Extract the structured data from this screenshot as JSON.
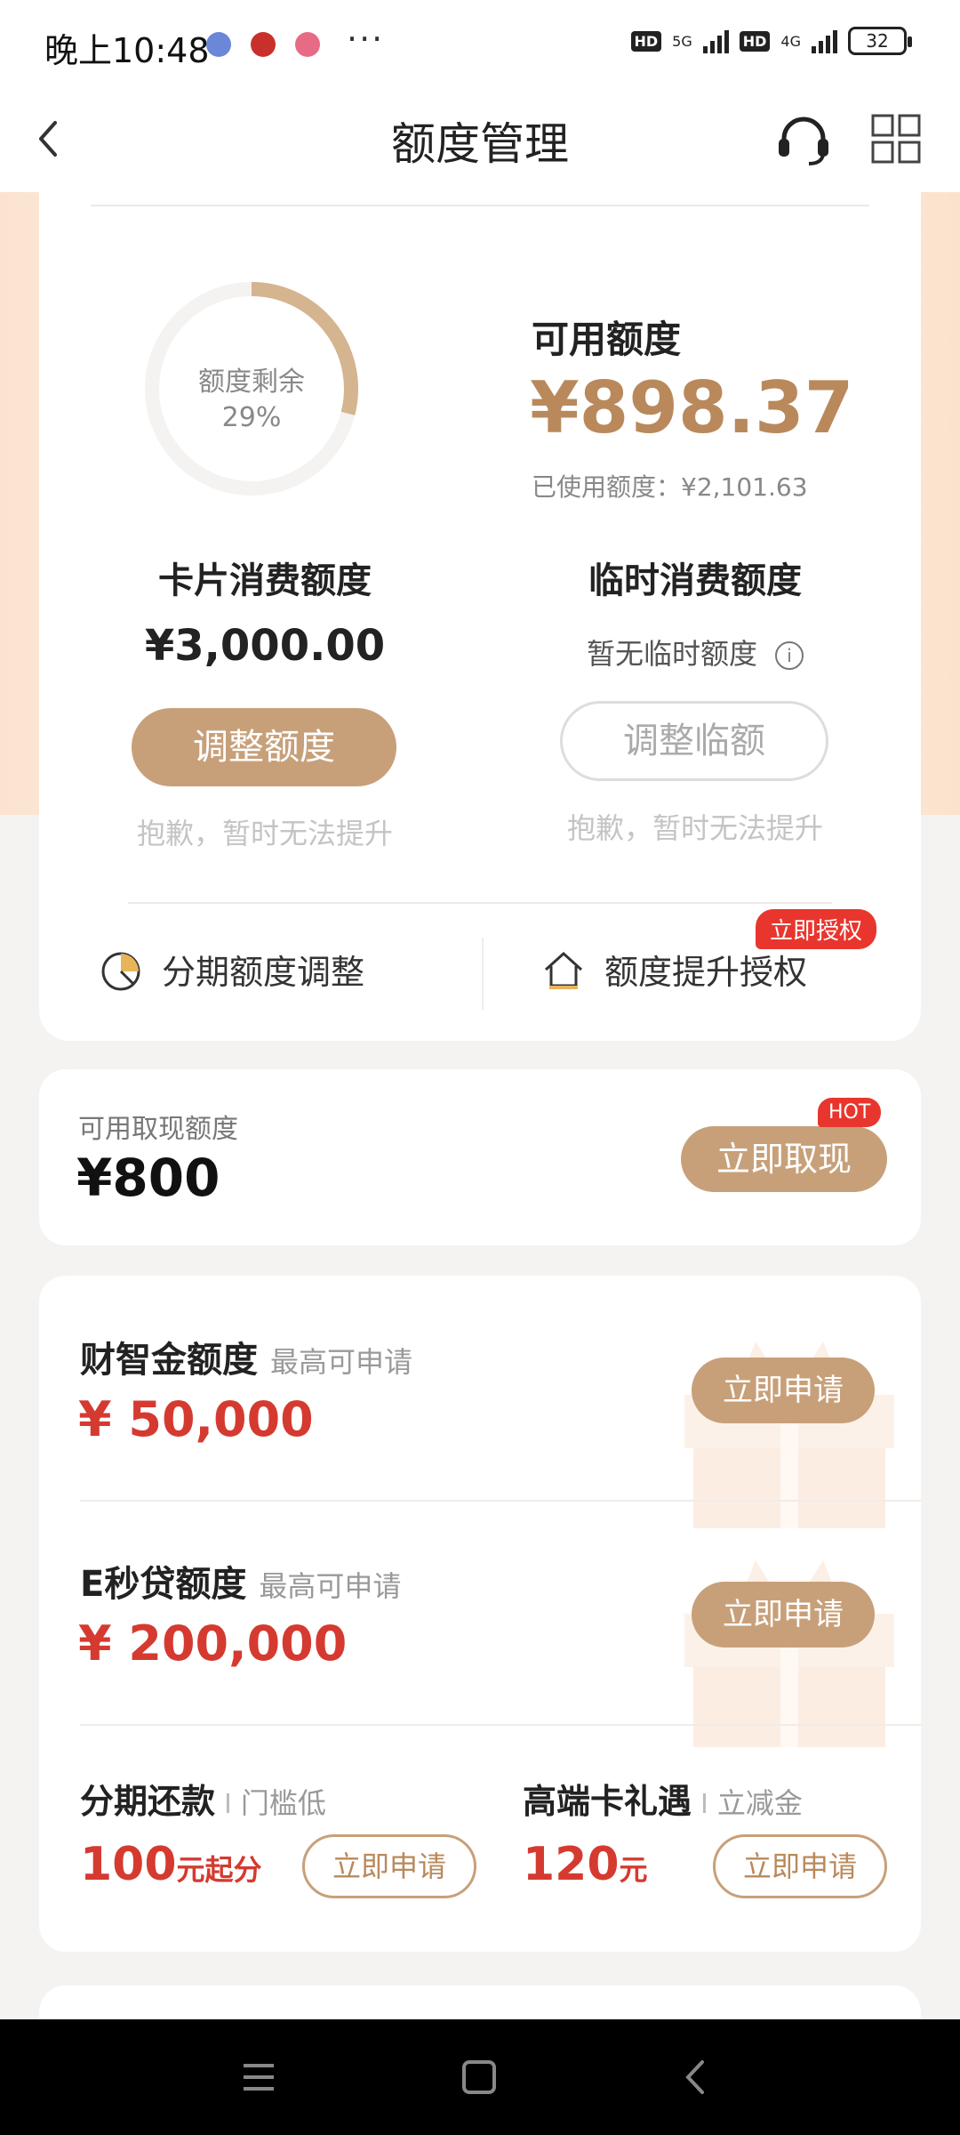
{
  "status_bar": {
    "time": "晚上10:48",
    "more": "···",
    "hd1": "HD",
    "net1": "5G",
    "hd2": "HD",
    "net2": "4G",
    "battery": "32"
  },
  "header": {
    "title": "额度管理",
    "back_icon": "chevron-left-icon",
    "service_icon": "headset-icon",
    "menu_icon": "grid-icon"
  },
  "credit": {
    "ring_label": "额度剩余",
    "ring_percent_text": "29%",
    "ring_fraction": 0.29,
    "available_label": "可用额度",
    "available_value": "¥898.37",
    "used_text": "已使用额度：¥2,101.63",
    "card_limit": {
      "title": "卡片消费额度",
      "amount": "¥3,000.00",
      "button": "调整额度",
      "hint": "抱歉，暂时无法提升"
    },
    "temp_limit": {
      "title": "临时消费额度",
      "note": "暂无临时额度",
      "info_glyph": "i",
      "button": "调整临额",
      "hint": "抱歉，暂时无法提升"
    },
    "installment_adjust": "分期额度调整",
    "raise_auth": "额度提升授权",
    "raise_tag": "立即授权"
  },
  "cash": {
    "label": "可用取现额度",
    "value": "¥800",
    "button": "立即取现",
    "tag": "HOT"
  },
  "loans": [
    {
      "title": "财智金额度",
      "sub": "最高可申请",
      "amount": "¥ 50,000",
      "button": "立即申请"
    },
    {
      "title": "E秒贷额度",
      "sub": "最高可申请",
      "amount": "¥ 200,000",
      "button": "立即申请"
    }
  ],
  "bottom": [
    {
      "title": "分期还款",
      "sep": "I",
      "sub": "门槛低",
      "big": "100",
      "unit": "元起分",
      "button": "立即申请"
    },
    {
      "title": "高端卡礼遇",
      "sep": "I",
      "sub": "立减金",
      "big": "120",
      "unit": "元",
      "button": "立即申请"
    }
  ],
  "colors": {
    "gold": "#c7a07a",
    "gold_text": "#b9895c",
    "red": "#d53a30",
    "tag_red": "#e8362e"
  }
}
